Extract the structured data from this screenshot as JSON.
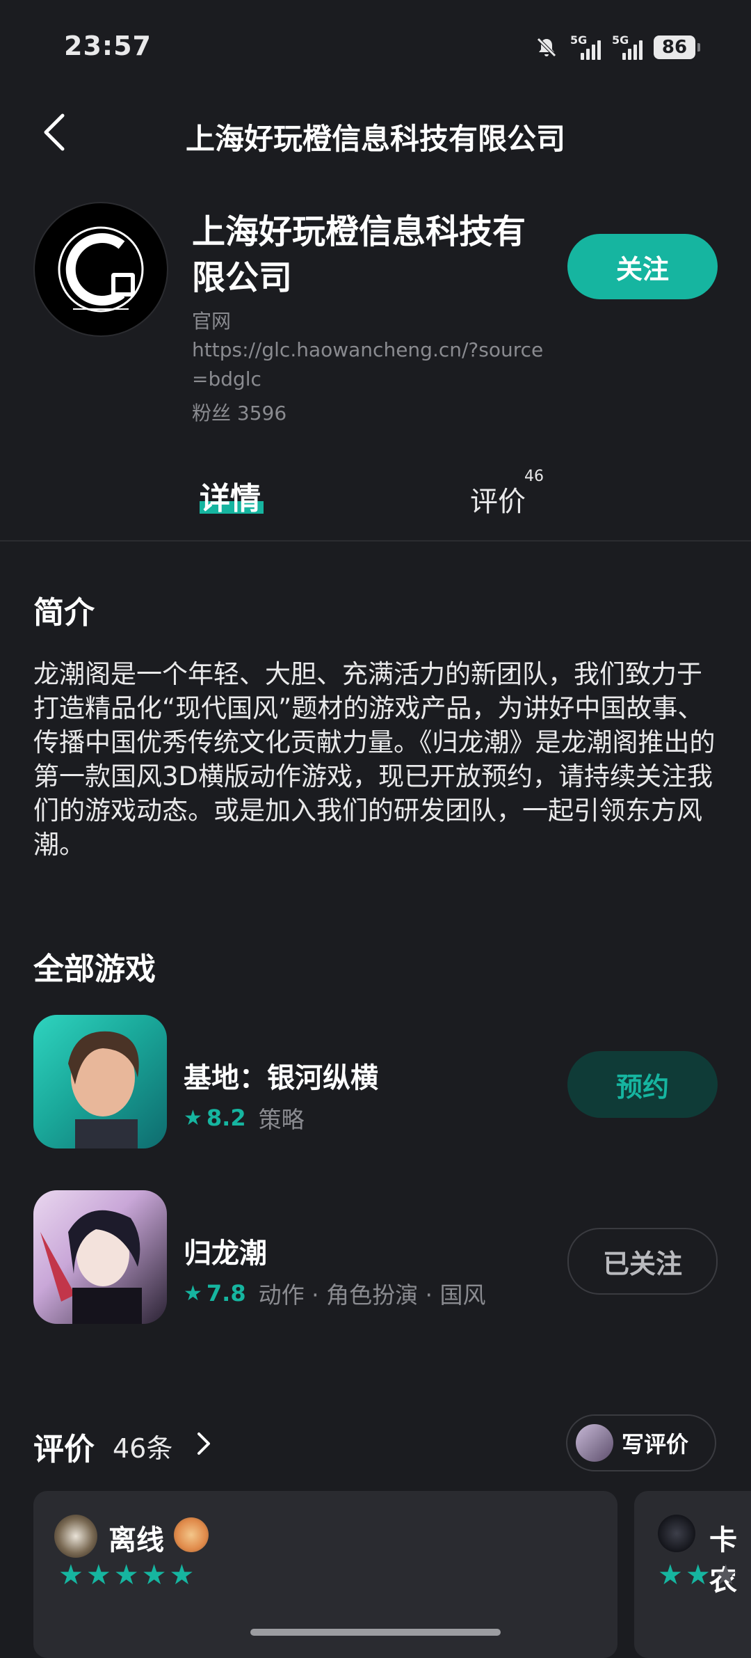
{
  "status_bar": {
    "time": "23:57",
    "network_1": "5G",
    "network_2": "5G",
    "battery": "86",
    "icons": [
      "mute-bell-icon",
      "signal-icon",
      "battery-icon"
    ]
  },
  "header": {
    "title": "上海好玩橙信息科技有限公司",
    "back_icon": "chevron-left-icon"
  },
  "profile": {
    "name": "上海好玩橙信息科技有限公司",
    "follow_label": "关注",
    "site_label": "官网",
    "site_url": "https://glc.haowancheng.cn/?source=bdglc",
    "fans": "粉丝 3596",
    "accent": "#16b5a0"
  },
  "tabs": [
    {
      "label": "详情",
      "active": true
    },
    {
      "label": "评价",
      "badge": "46",
      "active": false
    }
  ],
  "intro": {
    "title": "简介",
    "text": "龙潮阁是一个年轻、大胆、充满活力的新团队，我们致力于打造精品化“现代国风”题材的游戏产品，为讲好中国故事、传播中国优秀传统文化贡献力量。《归龙潮》是龙潮阁推出的第一款国风3D横版动作游戏，现已开放预约，请持续关注我们的游戏动态。或是加入我们的研发团队，一起引领东方风潮。"
  },
  "games": {
    "title": "全部游戏",
    "items": [
      {
        "name": "基地：银河纵横",
        "rating": "8.2",
        "genre": "策略",
        "action": "预约"
      },
      {
        "name": "归龙潮",
        "rating": "7.8",
        "genre": "动作 · 角色扮演 · 国风",
        "action": "已关注"
      }
    ]
  },
  "reviews": {
    "title": "评价",
    "count": "46条",
    "write_label": "写评价",
    "cards": [
      {
        "name": "离线",
        "stars": 5
      },
      {
        "name": "卡农",
        "stars": 2
      }
    ]
  }
}
